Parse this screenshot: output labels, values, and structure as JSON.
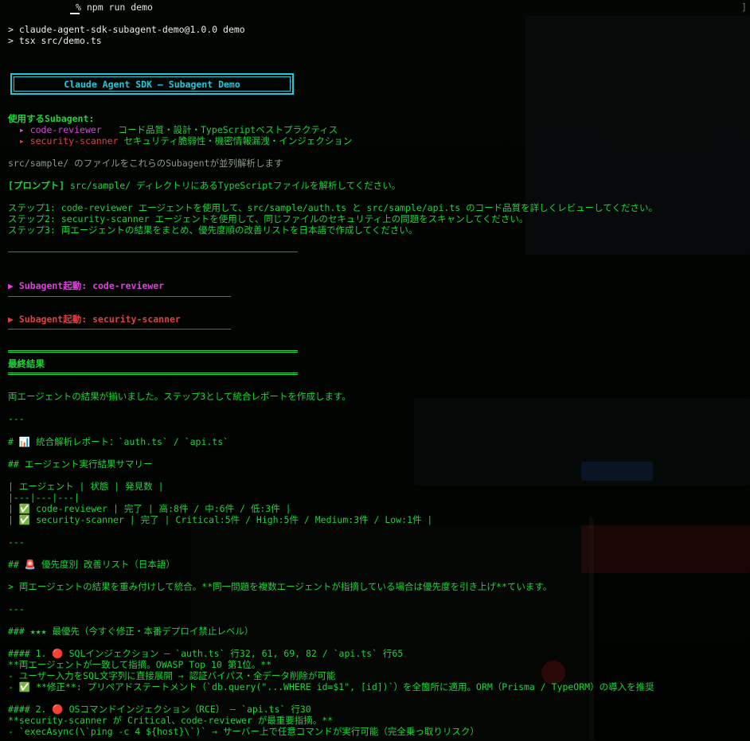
{
  "titlebar": {
    "command": "% npm run demo",
    "bracket": "]"
  },
  "lines": {
    "l1": "> claude-agent-sdk-subagent-demo@1.0.0 demo",
    "l2": "> tsx src/demo.ts",
    "banner": "Claude Agent SDK — Subagent Demo",
    "use_heading": "使用するSubagent:",
    "sa1_name": "▸ code-reviewer",
    "sa1_desc": "コード品質・設計・TypeScriptベストプラクティス",
    "sa2_name": "▸ security-scanner",
    "sa2_desc": "セキュリティ脆弱性・機密情報漏洩・インジェクション",
    "parallel": "src/sample/ のファイルをこれらのSubagentが並列解析します",
    "prompt_label": "[プロンプト]",
    "prompt_text": " src/sample/ ディレクトリにあるTypeScriptファイルを解析してください。",
    "step1": "ステップ1: code-reviewer エージェントを使用して、src/sample/auth.ts と src/sample/api.ts のコード品質を詳しくレビューしてください。",
    "step2": "ステップ2: security-scanner エージェントを使用して、同じファイルのセキュリティ上の問題をスキャンしてください。",
    "step3": "ステップ3: 両エージェントの結果をまとめ、優先度順の改善リストを日本語で作成してください。",
    "start_cr": "▶ Subagent起動: code-reviewer",
    "start_ss": "▶ Subagent起動: security-scanner",
    "final": "最終結果",
    "aligned": "両エージェントの結果が揃いました。ステップ3として統合レポートを作成します。",
    "hr1": "---",
    "report_title": "# 📊 統合解析レポート：`auth.ts` / `api.ts`",
    "summary_h": "## エージェント実行結果サマリー",
    "table_h": "| エージェント | 状態 | 発見数 |",
    "table_sep": "|---|---|---|",
    "row1": "| ✅ code-reviewer | 完了 | 高:8件 / 中:6件 / 低:3件 |",
    "row2": "| ✅ security-scanner | 完了 | Critical:5件 / High:5件 / Medium:3件 / Low:1件 |",
    "hr2": "---",
    "priority_h": "## 🚨 優先度別 改善リスト（日本語）",
    "quote": "> 両エージェントの結果を重み付けして統合。**同一問題を複数エージェントが指摘している場合は優先度を引き上げ**ています。",
    "hr3": "---",
    "top_h": "### ★★★ 最優先（今すぐ修正・本番デプロイ禁止レベル）",
    "i1_h": "#### 1. 🔴 SQLインジェクション — `auth.ts` 行32, 61, 69, 82 / `api.ts` 行65",
    "i1_a": "**両エージェントが一致して指摘。OWASP Top 10 第1位。**",
    "i1_b": "- ユーザー入力をSQL文字列に直接展開 → 認証バイパス・全データ削除が可能",
    "i1_c": "- ✅ **修正**: プリペアドステートメント（`db.query(\"...WHERE id=$1\", [id])`）を全箇所に適用。ORM（Prisma / TypeORM）の導入を推奨",
    "i2_h": "#### 2. 🔴 OSコマンドインジェクション（RCE） — `api.ts` 行30",
    "i2_a": "**security-scanner が Critical、code-reviewer が最重要指摘。**",
    "i2_b": "- `execAsync(\\`ping -c 4 ${host}\\`)` → サーバー上で任意コマンドが実行可能（完全乗っ取りリスク）"
  },
  "colors": {
    "green": "#1cd63a",
    "cyan": "#22c8d8",
    "magenta": "#e040e0",
    "red": "#e04040"
  }
}
